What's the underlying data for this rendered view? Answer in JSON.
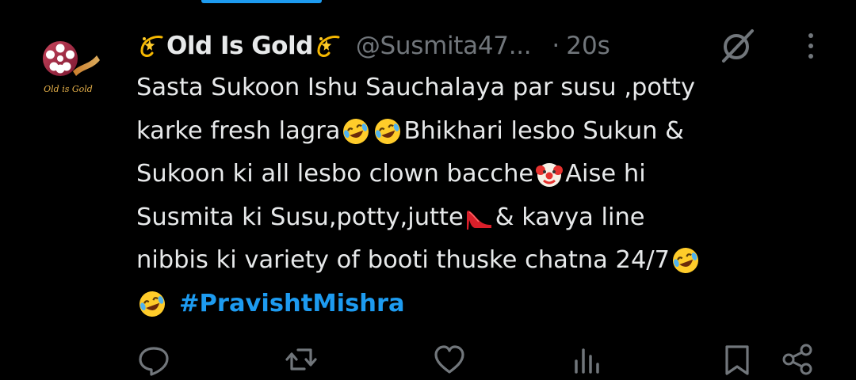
{
  "app": {
    "theme_bg": "#000000",
    "accent_color": "#1d9bf0",
    "muted_color": "#71767b",
    "text_color": "#e7e9ea"
  },
  "post": {
    "author": {
      "display_name": "Old Is Gold",
      "name_emoji": "dizzy-emoji",
      "handle": "@Susmita47...",
      "avatar_text": "Old is Gold"
    },
    "separator": "·",
    "timestamp": "20s",
    "header_icons": [
      "mute-icon",
      "more-icon"
    ],
    "lines": [
      {
        "text": "Sasta Sukoon Ishu Sauchalaya par susu ,potty"
      },
      {
        "text_a": "karke fresh lagra",
        "text_b": "Bhikhari lesbo Sukun &"
      },
      {
        "text_a": "Sukoon ki all lesbo clown bacche",
        "text_b": "Aise hi"
      },
      {
        "text_a": "Susmita ki Susu,potty,jutte",
        "text_b": " & kavya line"
      },
      {
        "text_a": "nibbis ki variety of booti thuske chatna 24/7"
      }
    ],
    "hashtag": "#PravishtMishra",
    "emojis": [
      "rofl-emoji",
      "clown-emoji",
      "high-heel-emoji"
    ]
  },
  "actions": [
    {
      "name": "reply-icon"
    },
    {
      "name": "repost-icon"
    },
    {
      "name": "like-icon"
    },
    {
      "name": "views-icon"
    },
    {
      "name": "bookmark-icon"
    },
    {
      "name": "share-icon"
    }
  ]
}
